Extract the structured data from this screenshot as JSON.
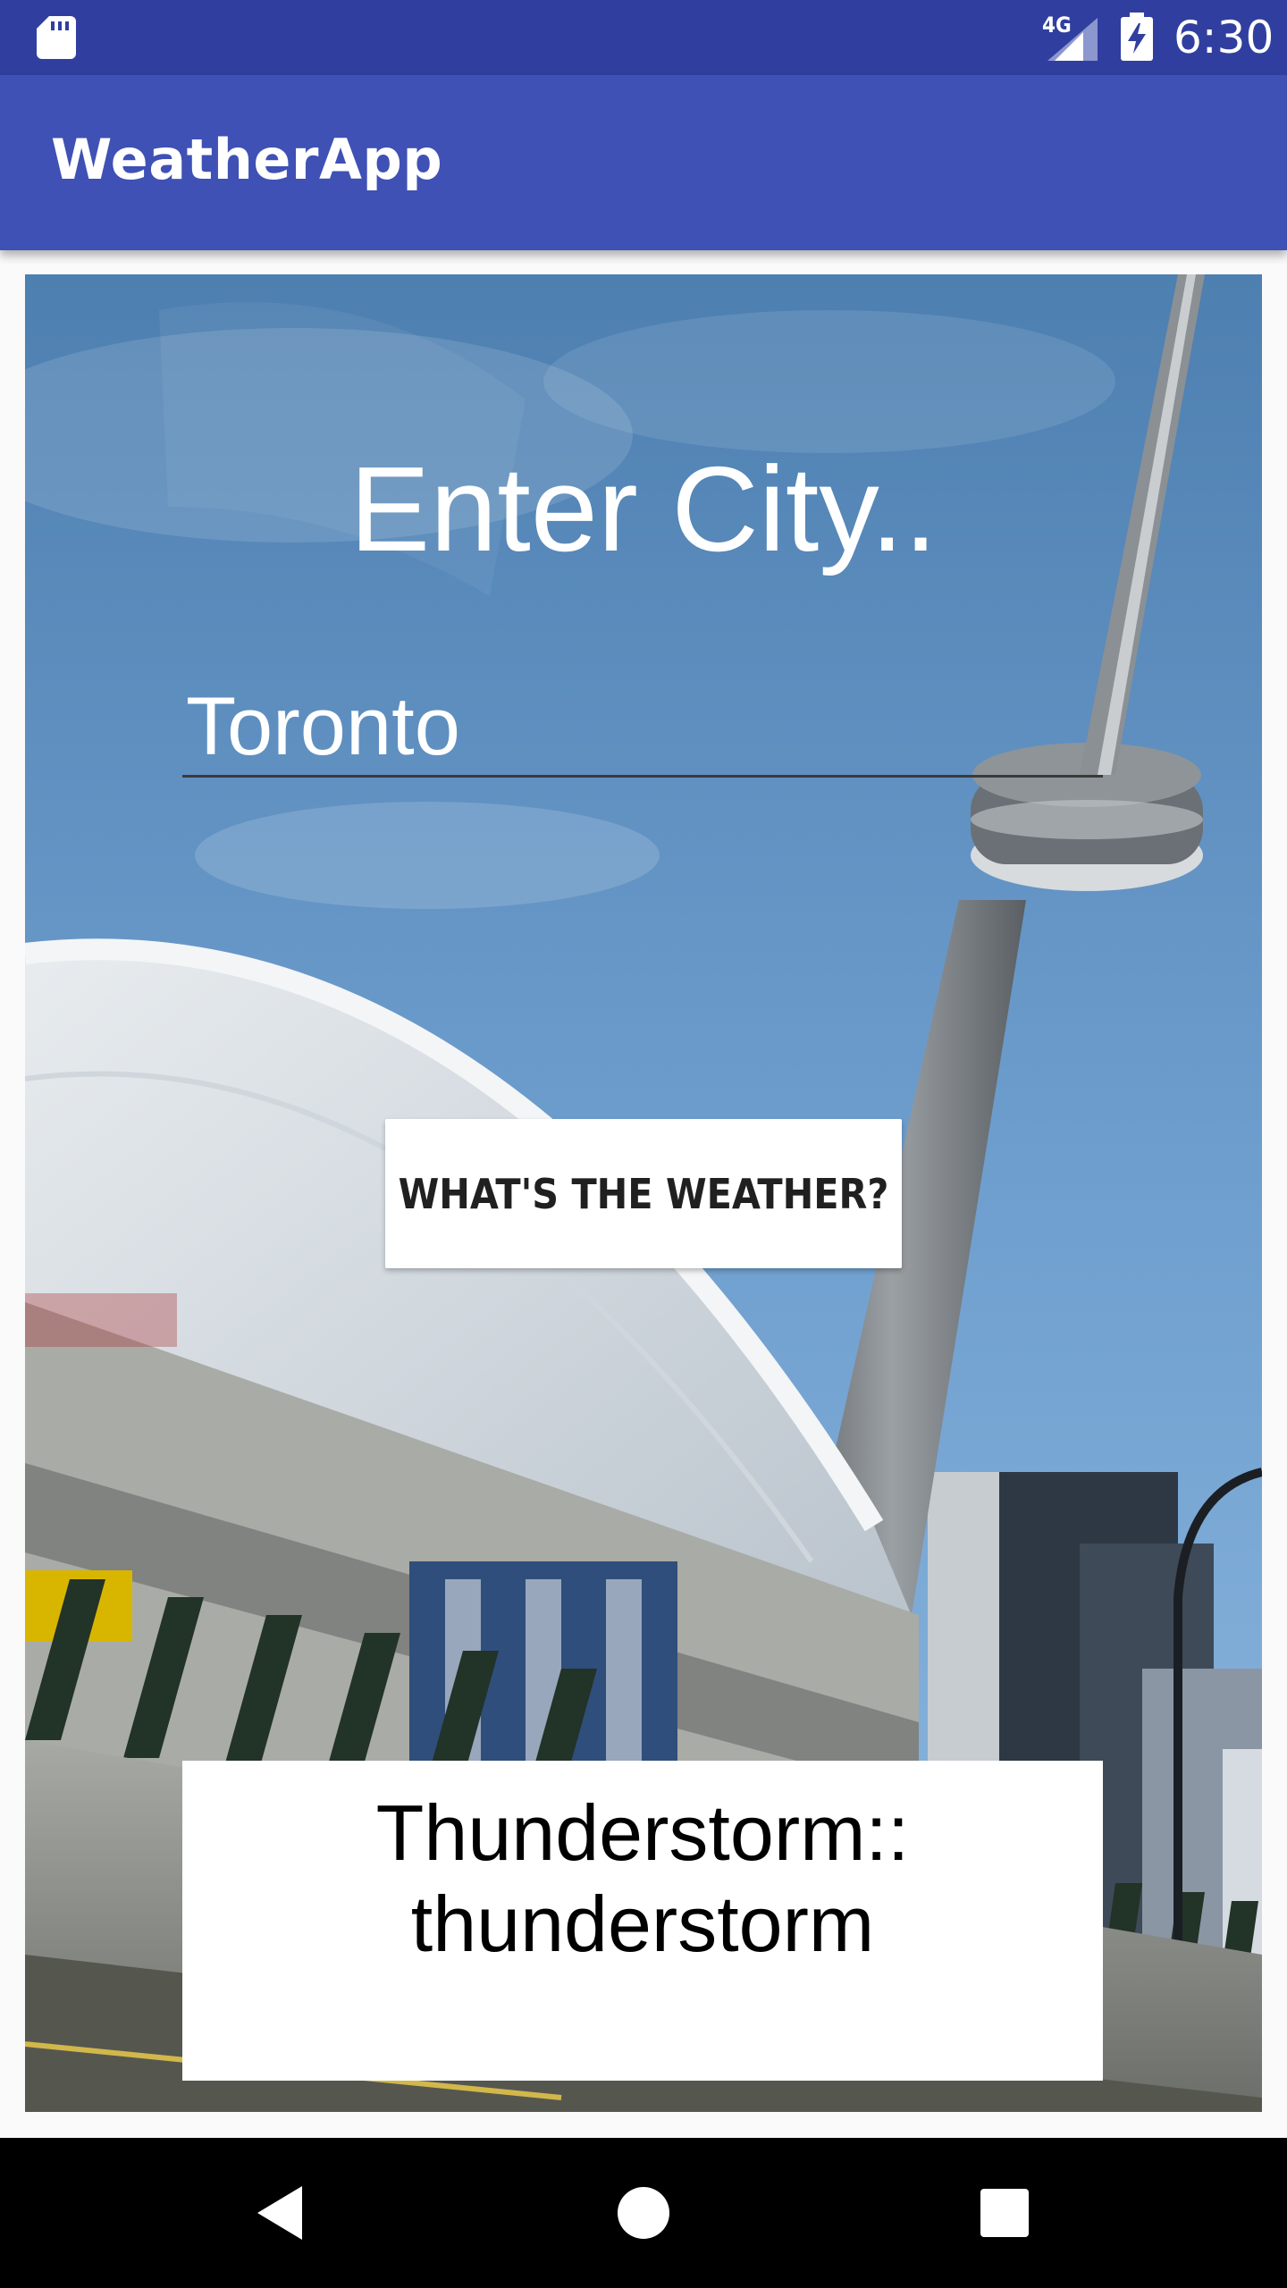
{
  "status_bar": {
    "network": "4G",
    "time": "6:30",
    "icons": [
      "sd-card-icon",
      "signal-icon",
      "battery-charging-icon"
    ]
  },
  "app_bar": {
    "title": "WeatherApp"
  },
  "main": {
    "heading": "Enter City..",
    "city_input": {
      "value": "Toronto",
      "placeholder": ""
    },
    "weather_button_label": "WHAT'S THE WEATHER?",
    "result_text": "Thunderstorm::\nthunderstorm",
    "background_image": "Toronto CN Tower and dome stadium photo"
  },
  "nav_bar": {
    "buttons": [
      "back-icon",
      "home-icon",
      "recents-icon"
    ]
  },
  "colors": {
    "status_bar": "#303f9f",
    "app_bar": "#3f51b5",
    "nav_bar": "#000000"
  }
}
